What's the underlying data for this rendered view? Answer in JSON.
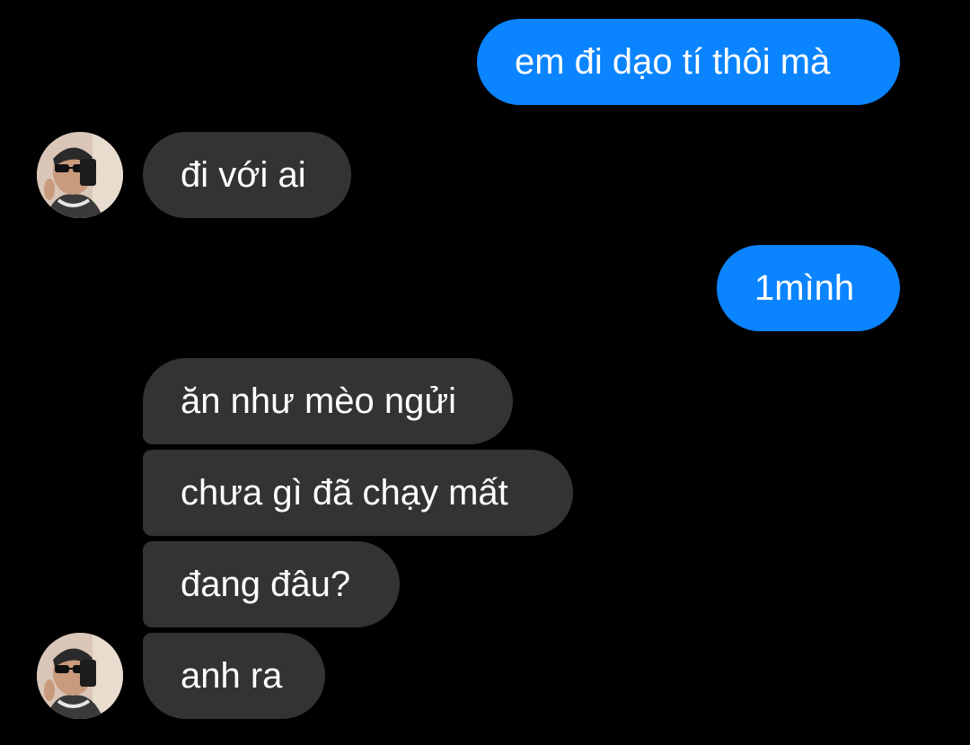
{
  "messages": [
    {
      "side": "outgoing",
      "text": "em đi dạo tí thôi mà"
    },
    {
      "side": "incoming",
      "text": "đi với ai",
      "avatar": "contact-avatar"
    },
    {
      "side": "outgoing",
      "text": "1mình"
    },
    {
      "side": "incoming",
      "text": "ăn như mèo ngửi"
    },
    {
      "side": "incoming",
      "text": "chưa gì đã chạy mất"
    },
    {
      "side": "incoming",
      "text": "đang đâu?"
    },
    {
      "side": "incoming",
      "text": "anh ra",
      "avatar": "contact-avatar"
    }
  ],
  "colors": {
    "background": "#000000",
    "outgoing_bubble": "#0a84ff",
    "incoming_bubble": "#333333",
    "text": "#ffffff"
  }
}
